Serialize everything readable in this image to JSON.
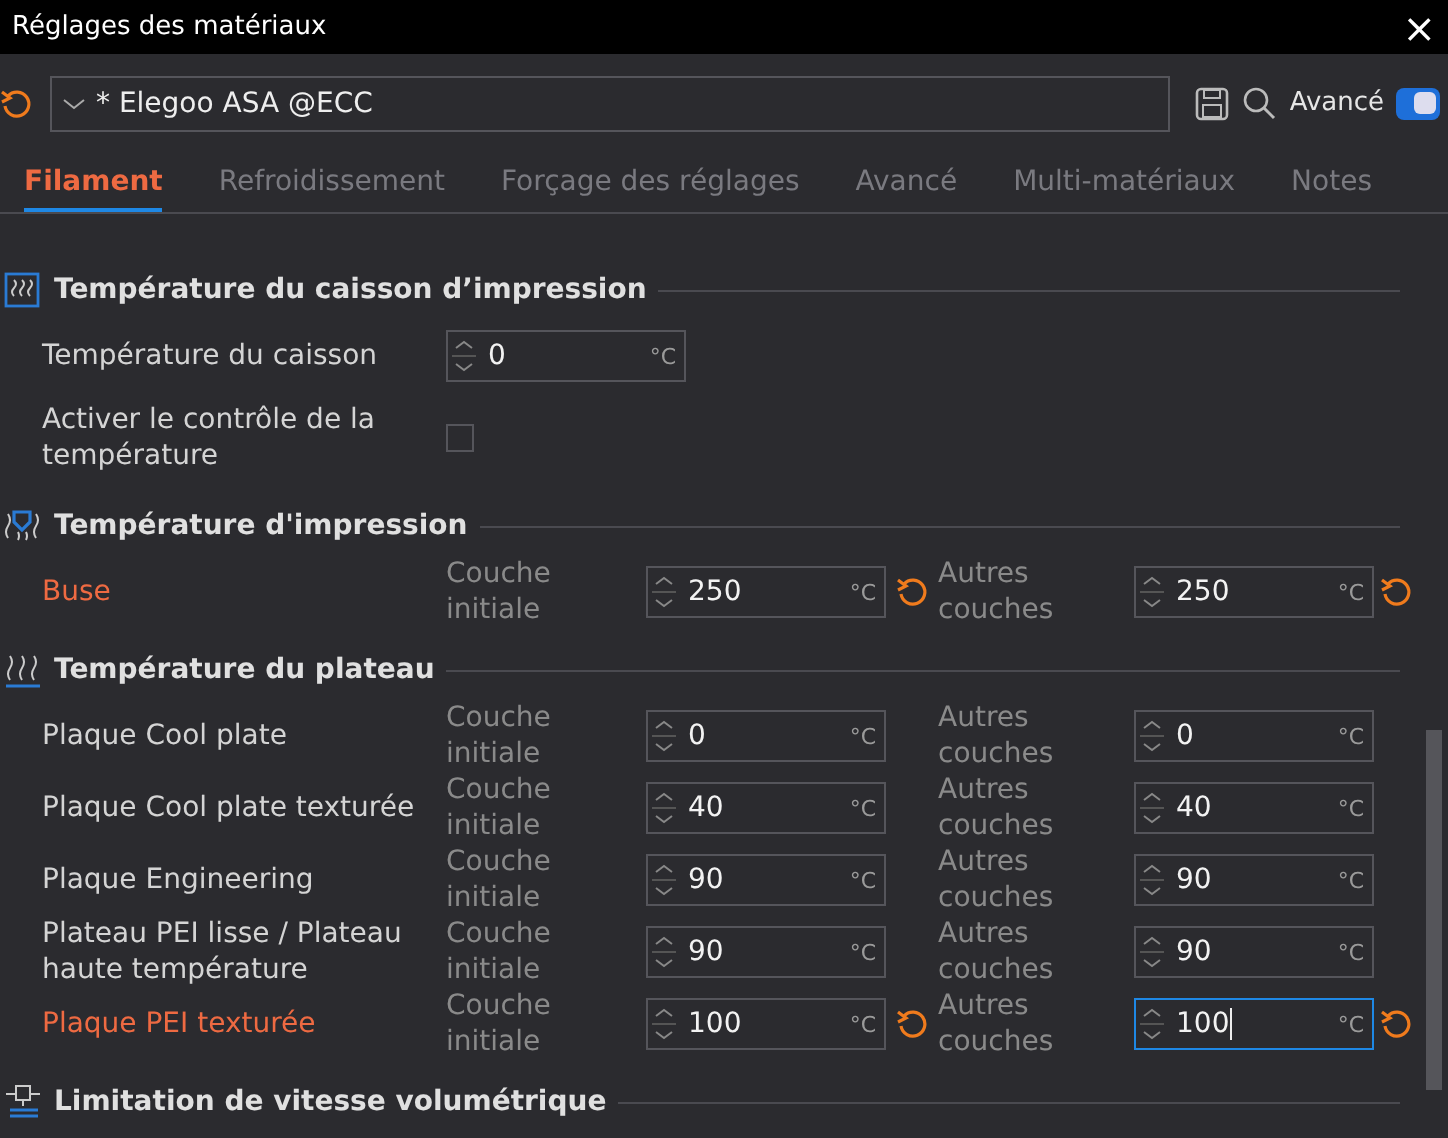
{
  "window": {
    "title": "Réglages des matériaux",
    "close": "×"
  },
  "preset": {
    "value": "* Elegoo ASA @ECC",
    "advanced": {
      "label": "Avancé",
      "on": true
    }
  },
  "tabs": [
    {
      "label": "Filament",
      "selected": true
    },
    {
      "label": "Refroidissement",
      "selected": false
    },
    {
      "label": "Forçage des réglages",
      "selected": false
    },
    {
      "label": "Avancé",
      "selected": false
    },
    {
      "label": "Multi-matériaux",
      "selected": false
    },
    {
      "label": "Notes",
      "selected": false
    }
  ],
  "sections": [
    {
      "title": "Température du caisson d’impression",
      "rows": [
        {
          "kind": "single",
          "label": "Température du caisson",
          "modified": false,
          "value": "0",
          "unit": "°C"
        },
        {
          "kind": "checkbox",
          "label": "Activer le contrôle de la température",
          "checked": false
        }
      ]
    },
    {
      "title": "Température d'impression",
      "rows": [
        {
          "kind": "pair",
          "label": "Buse",
          "modified": true,
          "fields": [
            {
              "caption": "Couche initiale",
              "value": "250",
              "unit": "°C",
              "reset": true,
              "focused": false
            },
            {
              "caption": "Autres couches",
              "value": "250",
              "unit": "°C",
              "reset": true,
              "focused": false
            }
          ]
        }
      ]
    },
    {
      "title": "Température du plateau",
      "rows": [
        {
          "kind": "pair",
          "label": "Plaque Cool plate",
          "modified": false,
          "fields": [
            {
              "caption": "Couche initiale",
              "value": "0",
              "unit": "°C",
              "reset": false,
              "focused": false
            },
            {
              "caption": "Autres couches",
              "value": "0",
              "unit": "°C",
              "reset": false,
              "focused": false
            }
          ]
        },
        {
          "kind": "pair",
          "label": "Plaque Cool plate texturée",
          "modified": false,
          "fields": [
            {
              "caption": "Couche initiale",
              "value": "40",
              "unit": "°C",
              "reset": false,
              "focused": false
            },
            {
              "caption": "Autres couches",
              "value": "40",
              "unit": "°C",
              "reset": false,
              "focused": false
            }
          ]
        },
        {
          "kind": "pair",
          "label": "Plaque Engineering",
          "modified": false,
          "fields": [
            {
              "caption": "Couche initiale",
              "value": "90",
              "unit": "°C",
              "reset": false,
              "focused": false
            },
            {
              "caption": "Autres couches",
              "value": "90",
              "unit": "°C",
              "reset": false,
              "focused": false
            }
          ]
        },
        {
          "kind": "pair",
          "label": "Plateau PEI lisse / Plateau haute température",
          "modified": false,
          "fields": [
            {
              "caption": "Couche initiale",
              "value": "90",
              "unit": "°C",
              "reset": false,
              "focused": false
            },
            {
              "caption": "Autres couches",
              "value": "90",
              "unit": "°C",
              "reset": false,
              "focused": false
            }
          ]
        },
        {
          "kind": "pair",
          "label": "Plaque PEI texturée",
          "modified": true,
          "fields": [
            {
              "caption": "Couche initiale",
              "value": "100",
              "unit": "°C",
              "reset": true,
              "focused": false
            },
            {
              "caption": "Autres couches",
              "value": "100",
              "unit": "°C",
              "reset": true,
              "focused": true
            }
          ]
        }
      ]
    },
    {
      "title": "Limitation de vitesse volumétrique"
    }
  ]
}
